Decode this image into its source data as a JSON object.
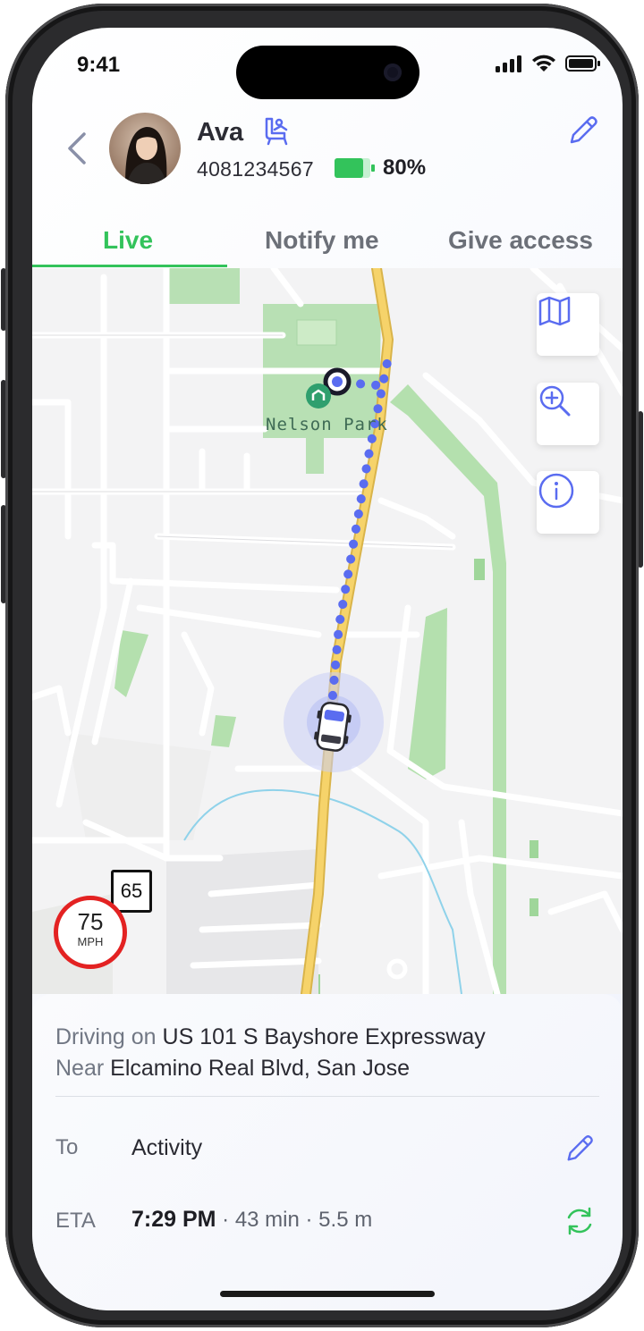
{
  "status_bar": {
    "time": "9:41"
  },
  "contact": {
    "name": "Ava",
    "phone": "4081234567",
    "battery_percent": "80%",
    "battery_level": 0.8
  },
  "tabs": [
    {
      "label": "Live",
      "active": true
    },
    {
      "label": "Notify me",
      "active": false
    },
    {
      "label": "Give access",
      "active": false
    }
  ],
  "map": {
    "place_label": "Nelson Park",
    "current_speed": "75",
    "speed_unit": "MPH",
    "speed_limit": "65",
    "controls": [
      "map-icon",
      "zoom-in-icon",
      "info-icon"
    ]
  },
  "trip": {
    "driving_prefix": "Driving on",
    "road": "US 101 S Bayshore Expressway",
    "near_prefix": "Near",
    "near_place": "Elcamino Real Blvd, San Jose",
    "to_label": "To",
    "destination": "Activity",
    "eta_label": "ETA",
    "eta_time": "7:29 PM",
    "eta_details": " · 43 min · 5.5 m"
  },
  "colors": {
    "accent_green": "#33c35b",
    "accent_blue": "#5a6cf0",
    "speed_red": "#e32222",
    "route_road": "#f2c64d"
  }
}
